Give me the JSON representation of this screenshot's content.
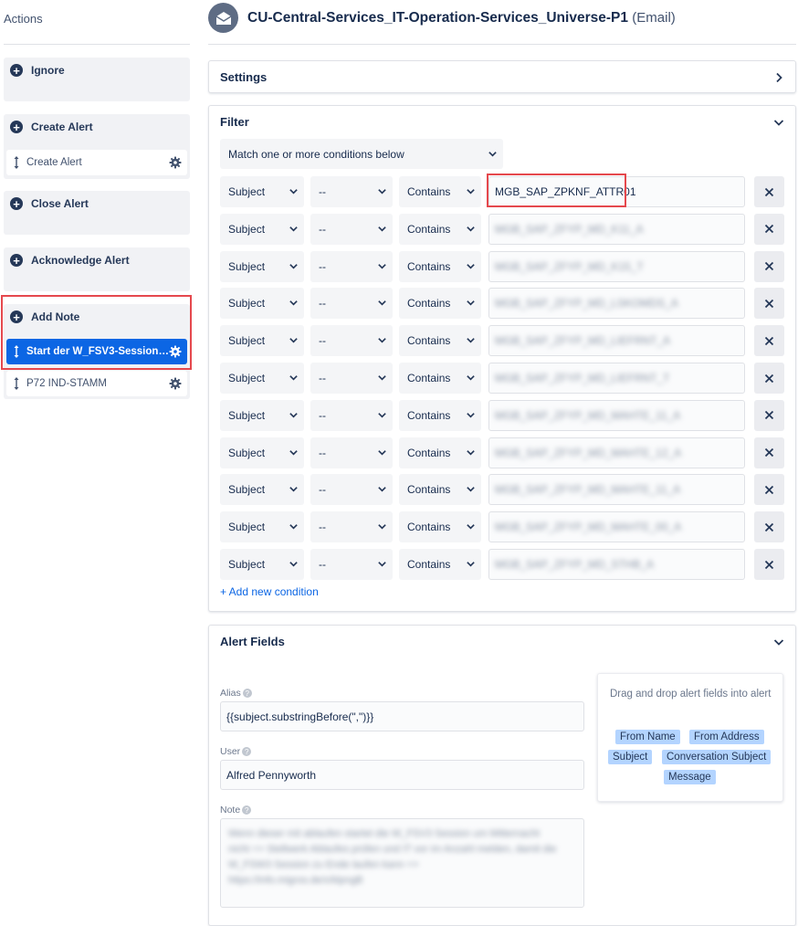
{
  "sidebar": {
    "title": "Actions",
    "groups": [
      {
        "label": "Ignore"
      },
      {
        "label": "Create Alert",
        "items": [
          {
            "label": "Create Alert"
          }
        ]
      },
      {
        "label": "Close Alert"
      },
      {
        "label": "Acknowledge Alert"
      },
      {
        "label": "Add Note",
        "items": [
          {
            "label": "Start der W_FSV3-Session ..."
          },
          {
            "label": "P72 IND-STAMM"
          }
        ]
      }
    ]
  },
  "header": {
    "title": "CU-Central-Services_IT-Operation-Services_Universe-P1",
    "type": "(Email)"
  },
  "settings": {
    "title": "Settings"
  },
  "filter": {
    "title": "Filter",
    "match_mode": "Match one or more conditions below",
    "conditions": [
      {
        "field": "Subject",
        "negate": "--",
        "op": "Contains",
        "value": "MGB_SAP_ZPKNF_ATTR01"
      },
      {
        "field": "Subject",
        "negate": "--",
        "op": "Contains",
        "value": "MGB_SAP_ZFYP_MD_K11_A"
      },
      {
        "field": "Subject",
        "negate": "--",
        "op": "Contains",
        "value": "MGB_SAP_ZFYP_MD_K15_T"
      },
      {
        "field": "Subject",
        "negate": "--",
        "op": "Contains",
        "value": "MGB_SAP_ZFYP_MD_LSKOMDS_A"
      },
      {
        "field": "Subject",
        "negate": "--",
        "op": "Contains",
        "value": "MGB_SAP_ZFYP_MD_LIEFRNT_A"
      },
      {
        "field": "Subject",
        "negate": "--",
        "op": "Contains",
        "value": "MGB_SAP_ZFYP_MD_LIEFRNT_T"
      },
      {
        "field": "Subject",
        "negate": "--",
        "op": "Contains",
        "value": "MGB_SAP_ZFYP_MD_MAHTE_11_A"
      },
      {
        "field": "Subject",
        "negate": "--",
        "op": "Contains",
        "value": "MGB_SAP_ZFYP_MD_MAHTE_12_A"
      },
      {
        "field": "Subject",
        "negate": "--",
        "op": "Contains",
        "value": "MGB_SAP_ZFYP_MD_MAHTE_11_A"
      },
      {
        "field": "Subject",
        "negate": "--",
        "op": "Contains",
        "value": "MGB_SAP_ZFYP_MD_MAHTE_00_A"
      },
      {
        "field": "Subject",
        "negate": "--",
        "op": "Contains",
        "value": "MGB_SAP_ZFYP_MD_STHB_A"
      }
    ],
    "add_label": "+ Add new condition"
  },
  "alert_fields": {
    "title": "Alert Fields",
    "alias_label": "Alias",
    "alias_value": "{{subject.substringBefore(\",\")}}",
    "user_label": "User",
    "user_value": "Alfred Pennyworth",
    "note_label": "Note",
    "note_lines": [
      "Wenn dieser mit ablaufen startet die W_FSV3 Session um Mitternacht",
      "nicht => Stellwerk Ablaufes prüfen und IT vor im Anzahl melden, damit die",
      "W_FSW3 Session zu Ende laufen kann =>",
      "https://info.migros.de/x/klpngB"
    ],
    "dnd_hint": "Drag and drop alert fields into alert",
    "chips": [
      "From Name",
      "From Address",
      "Subject",
      "Conversation Subject",
      "Message"
    ]
  }
}
